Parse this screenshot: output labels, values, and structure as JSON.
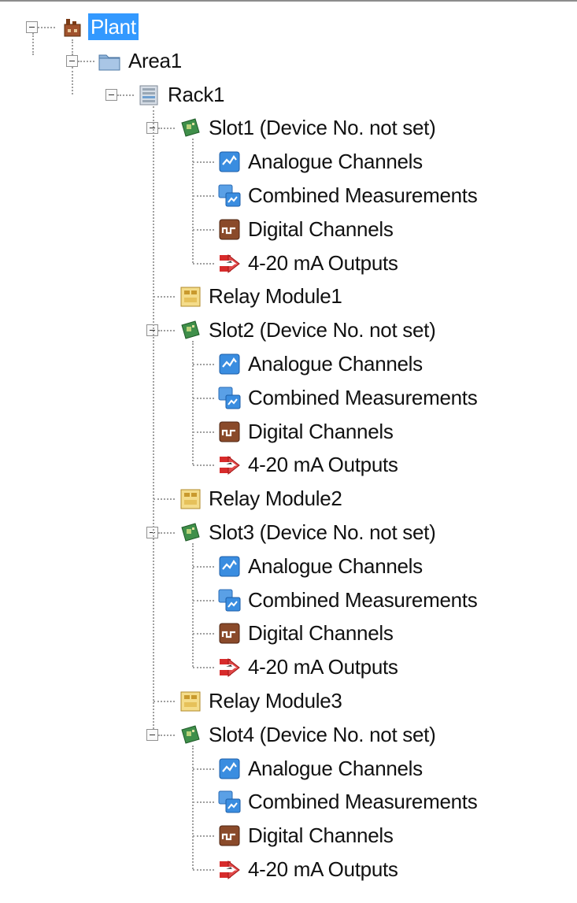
{
  "tree": {
    "root": {
      "label": "Plant",
      "icon": "plant-icon",
      "selected": true
    },
    "area": {
      "label": "Area1",
      "icon": "folder-icon"
    },
    "rack": {
      "label": "Rack1",
      "icon": "rack-icon"
    },
    "slots": [
      {
        "label": "Slot1 (Device No. not set)",
        "icon": "slot-card-icon",
        "children": [
          {
            "label": "Analogue Channels",
            "icon": "analogue-channels-icon"
          },
          {
            "label": "Combined Measurements",
            "icon": "combined-measurements-icon"
          },
          {
            "label": "Digital Channels",
            "icon": "digital-channels-icon"
          },
          {
            "label": "4-20 mA Outputs",
            "icon": "ma-outputs-icon"
          }
        ]
      },
      {
        "label": "Relay Module1",
        "icon": "relay-module-icon"
      },
      {
        "label": "Slot2 (Device No. not set)",
        "icon": "slot-card-icon",
        "children": [
          {
            "label": "Analogue Channels",
            "icon": "analogue-channels-icon"
          },
          {
            "label": "Combined Measurements",
            "icon": "combined-measurements-icon"
          },
          {
            "label": "Digital Channels",
            "icon": "digital-channels-icon"
          },
          {
            "label": "4-20 mA Outputs",
            "icon": "ma-outputs-icon"
          }
        ]
      },
      {
        "label": "Relay Module2",
        "icon": "relay-module-icon"
      },
      {
        "label": "Slot3 (Device No. not set)",
        "icon": "slot-card-icon",
        "children": [
          {
            "label": "Analogue Channels",
            "icon": "analogue-channels-icon"
          },
          {
            "label": "Combined Measurements",
            "icon": "combined-measurements-icon"
          },
          {
            "label": "Digital Channels",
            "icon": "digital-channels-icon"
          },
          {
            "label": "4-20 mA Outputs",
            "icon": "ma-outputs-icon"
          }
        ]
      },
      {
        "label": "Relay Module3",
        "icon": "relay-module-icon"
      },
      {
        "label": "Slot4 (Device No. not set)",
        "icon": "slot-card-icon",
        "children": [
          {
            "label": "Analogue Channels",
            "icon": "analogue-channels-icon"
          },
          {
            "label": "Combined Measurements",
            "icon": "combined-measurements-icon"
          },
          {
            "label": "Digital Channels",
            "icon": "digital-channels-icon"
          },
          {
            "label": "4-20 mA Outputs",
            "icon": "ma-outputs-icon"
          }
        ]
      }
    ]
  },
  "colors": {
    "selection": "#3399ff",
    "tree_lines": "#a0a0a0"
  }
}
